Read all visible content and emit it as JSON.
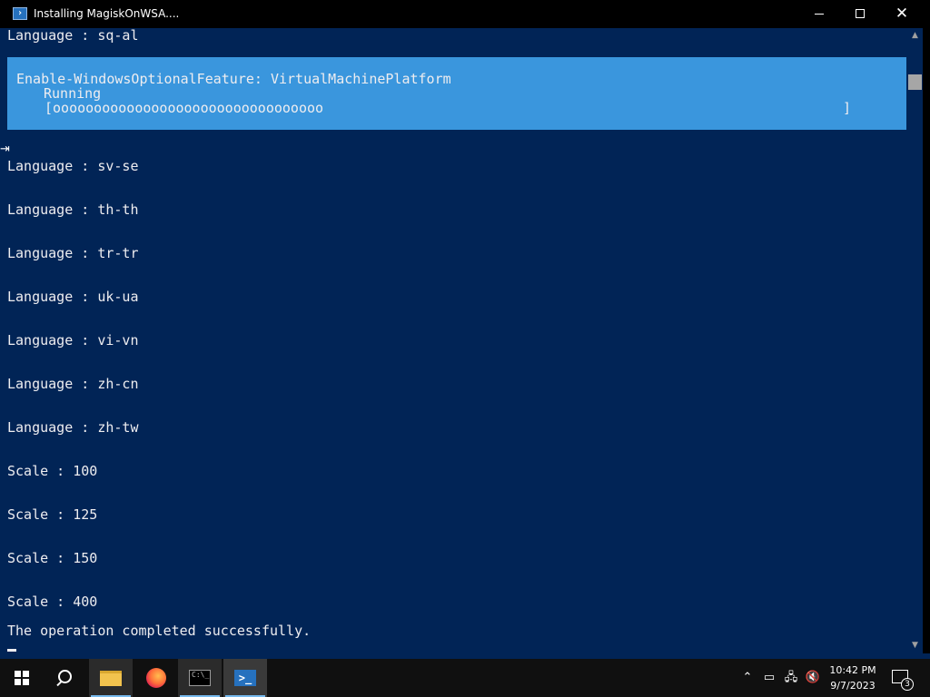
{
  "window": {
    "title": "Installing MagiskOnWSA....",
    "icon": "powershell-icon",
    "controls": {
      "minimize": "minimize-icon",
      "maximize": "maximize-icon",
      "close": "✕"
    }
  },
  "console": {
    "top_line": "Language : sq-al",
    "progress": {
      "activity": "Enable-WindowsOptionalFeature: VirtualMachinePlatform",
      "status": "Running",
      "bar_text": "[ooooooooooooooooooooooooooooooooo",
      "bar_end": "]"
    },
    "lines": [
      "Language : sv-se",
      "Language : th-th",
      "Language : tr-tr",
      "Language : uk-ua",
      "Language : vi-vn",
      "Language : zh-cn",
      "Language : zh-tw",
      "Scale : 100",
      "Scale : 125",
      "Scale : 150",
      "Scale : 400"
    ],
    "final": "The operation completed successfully.",
    "colors": {
      "background": "#012456",
      "text": "#eeedf0",
      "progress_bg": "#3a96dd"
    }
  },
  "scrollbar": {
    "up": "▲",
    "down": "▼"
  },
  "taskbar": {
    "items": [
      "start-icon",
      "search-icon",
      "file-explorer-icon",
      "firefox-icon",
      "command-prompt-icon",
      "powershell-icon"
    ],
    "cmd_label": "C:\\_",
    "ps_label": ">_",
    "tray": {
      "chevron": "⌃"
    },
    "clock_time": "10:42 PM",
    "clock_date": "9/7/2023",
    "notifications_count": "3"
  }
}
